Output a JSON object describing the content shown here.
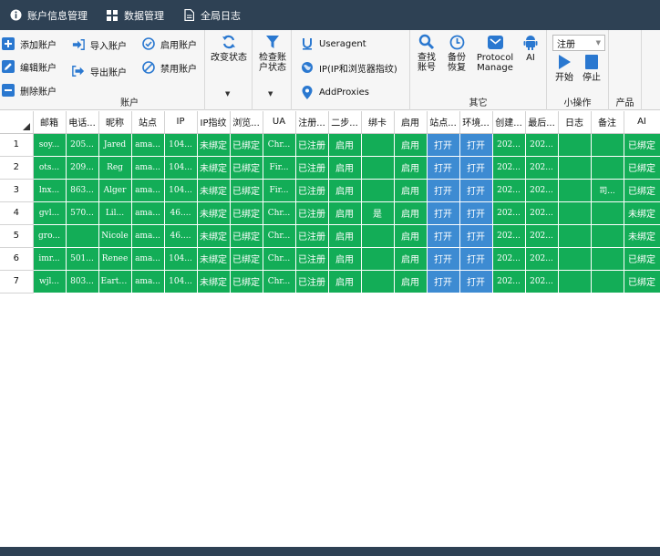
{
  "tabs": [
    {
      "label": "账户信息管理",
      "icon": "info-icon"
    },
    {
      "label": "数据管理",
      "icon": "grid-icon"
    },
    {
      "label": "全局日志",
      "icon": "document-icon"
    }
  ],
  "ribbon": {
    "accounts": {
      "label": "账户",
      "add": "添加账户",
      "edit": "编辑账户",
      "delete": "删除账户",
      "import": "导入账户",
      "export": "导出账户",
      "enable": "启用账户",
      "disable": "禁用账户"
    },
    "change_status": "改变状态",
    "check_status": [
      "检查账",
      "户状态"
    ],
    "proxy": {
      "useragent": "Useragent",
      "ip": "IP(IP和浏览器指纹)",
      "addproxies": "AddProxies"
    },
    "other": {
      "label": "其它",
      "find": [
        "查找",
        "账号"
      ],
      "backup": [
        "备份",
        "恢复"
      ],
      "protocol": [
        "Protocol",
        "Manage"
      ],
      "ai": "AI"
    },
    "small_ops": {
      "label": "小操作",
      "select_value": "注册",
      "start": "开始",
      "stop": "停止"
    },
    "product": {
      "label": "产品"
    }
  },
  "grid": {
    "columns": [
      "邮箱",
      "电话...",
      "昵称",
      "站点",
      "IP",
      "IP指纹",
      "浏览...",
      "UA",
      "注册...",
      "二步...",
      "绑卡",
      "启用",
      "站点...",
      "环境...",
      "创建...",
      "最后...",
      "日志",
      "备注",
      "AI"
    ],
    "rows": [
      [
        "1",
        "soy...",
        "205...",
        "Jared",
        "ama...",
        "104...",
        "未绑定",
        "已绑定",
        "Chr...",
        "已注册",
        "启用",
        "",
        "启用",
        "打开",
        "打开",
        "202...",
        "202...",
        "",
        "",
        "已绑定"
      ],
      [
        "2",
        "ots...",
        "209...",
        "Reg",
        "ama...",
        "104...",
        "未绑定",
        "已绑定",
        "Fir...",
        "已注册",
        "启用",
        "",
        "启用",
        "打开",
        "打开",
        "202...",
        "202...",
        "",
        "",
        "已绑定"
      ],
      [
        "3",
        "lnx...",
        "863...",
        "Alger",
        "ama...",
        "104...",
        "未绑定",
        "已绑定",
        "Fir...",
        "已注册",
        "启用",
        "",
        "启用",
        "打开",
        "打开",
        "202...",
        "202...",
        "",
        "司...",
        "已绑定"
      ],
      [
        "4",
        "gvl...",
        "570...",
        "Lil...",
        "ama...",
        "46....",
        "未绑定",
        "已绑定",
        "Chr...",
        "已注册",
        "启用",
        "是",
        "启用",
        "打开",
        "打开",
        "202...",
        "202...",
        "",
        "",
        "未绑定"
      ],
      [
        "5",
        "gro...",
        "",
        "Nicole",
        "ama...",
        "46....",
        "未绑定",
        "已绑定",
        "Chr...",
        "已注册",
        "启用",
        "",
        "启用",
        "打开",
        "打开",
        "202...",
        "202...",
        "",
        "",
        "未绑定"
      ],
      [
        "6",
        "imr...",
        "501...",
        "Renee",
        "ama...",
        "104...",
        "未绑定",
        "已绑定",
        "Chr...",
        "已注册",
        "启用",
        "",
        "启用",
        "打开",
        "打开",
        "202...",
        "202...",
        "",
        "",
        "已绑定"
      ],
      [
        "7",
        "wjl...",
        "803...",
        "Eartha",
        "ama...",
        "104...",
        "未绑定",
        "已绑定",
        "Chr...",
        "已注册",
        "启用",
        "",
        "启用",
        "打开",
        "打开",
        "202...",
        "202...",
        "",
        "",
        "已绑定"
      ]
    ]
  },
  "colors": {
    "header_bg": "#2e4154",
    "row_green": "#13ad57",
    "cell_blue": "#3d8bd2",
    "accent_blue": "#2a78d0"
  }
}
